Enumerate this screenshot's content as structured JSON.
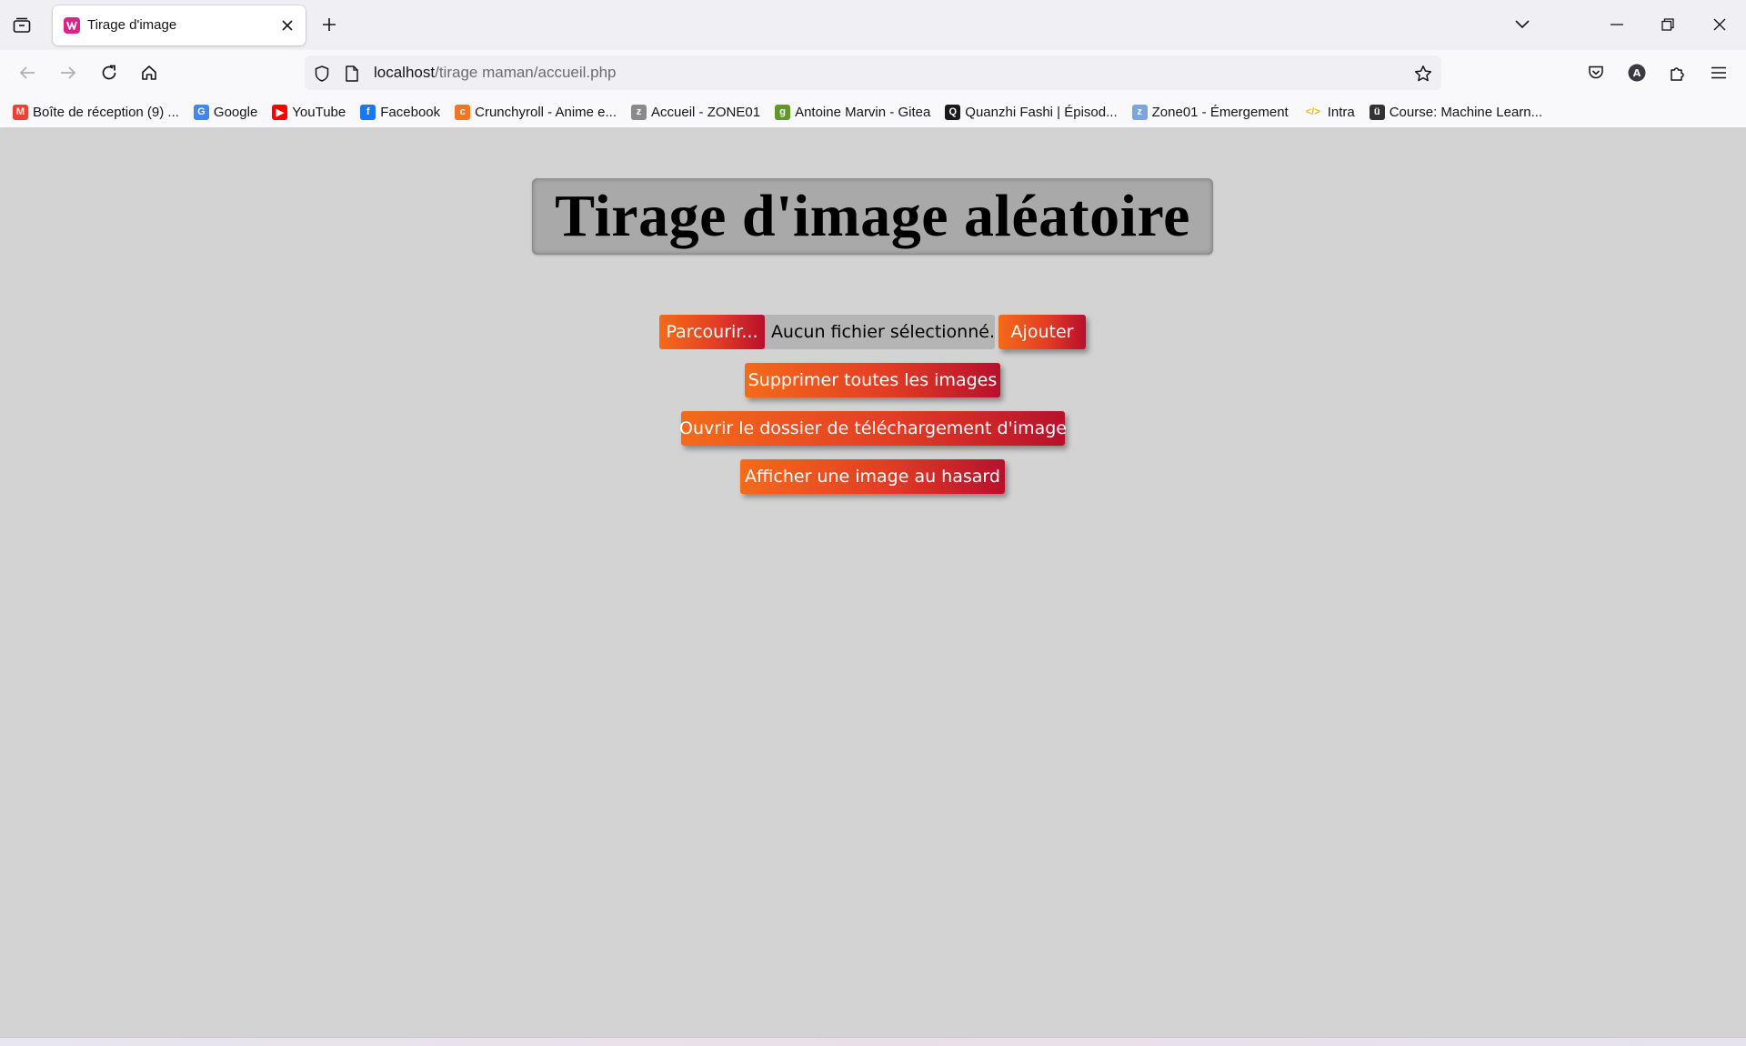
{
  "browser": {
    "tab": {
      "title": "Tirage d'image"
    },
    "url": {
      "host": "localhost",
      "path": "/tirage maman/accueil.php"
    },
    "bookmarks": [
      {
        "label": "Boîte de réception (9) ...",
        "icon": "gmail-icon",
        "color": "#ea4335",
        "glyph": "M"
      },
      {
        "label": "Google",
        "icon": "google-icon",
        "color": "#4285f4",
        "glyph": "G"
      },
      {
        "label": "YouTube",
        "icon": "youtube-icon",
        "color": "#ff0000",
        "glyph": "▶"
      },
      {
        "label": "Facebook",
        "icon": "facebook-icon",
        "color": "#1877f2",
        "glyph": "f"
      },
      {
        "label": "Crunchyroll - Anime e...",
        "icon": "crunchyroll-icon",
        "color": "#f47521",
        "glyph": "c"
      },
      {
        "label": "Accueil - ZONE01",
        "icon": "zone01-icon",
        "color": "#8a8a8a",
        "glyph": "z"
      },
      {
        "label": "Antoine Marvin - Gitea",
        "icon": "gitea-icon",
        "color": "#609926",
        "glyph": "g"
      },
      {
        "label": "Quanzhi Fashi | Épisod...",
        "icon": "quanzhi-icon",
        "color": "#1a1a1a",
        "glyph": "Q"
      },
      {
        "label": "Zone01 - Émergement",
        "icon": "emergement-icon",
        "color": "#7aa6e0",
        "glyph": "z"
      },
      {
        "label": "Intra",
        "icon": "code-icon",
        "color": "#f2b705",
        "glyph": "</>"
      },
      {
        "label": "Course: Machine Learn...",
        "icon": "course-icon",
        "color": "#333333",
        "glyph": "ü"
      }
    ]
  },
  "page": {
    "title": "Tirage d'image aléatoire",
    "file_input": {
      "browse_label": "Parcourir...",
      "status": "Aucun fichier sélectionné."
    },
    "add_label": "Ajouter",
    "delete_all_label": "Supprimer toutes les images",
    "open_folder_label": "Ouvrir le dossier de téléchargement d'image",
    "random_label": "Afficher une image au hasard"
  }
}
